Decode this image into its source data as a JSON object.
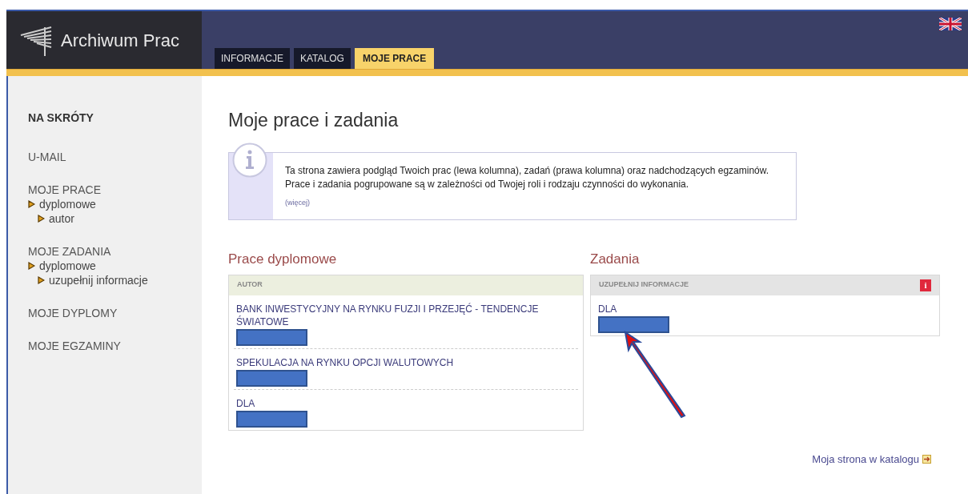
{
  "header": {
    "logo_text": "Archiwum Prac",
    "tabs": [
      {
        "label": "INFORMACJE",
        "selected": false
      },
      {
        "label": "KATALOG",
        "selected": false
      },
      {
        "label": "MOJE PRACE",
        "selected": true
      }
    ]
  },
  "sidebar": {
    "heading": "NA SKRÓTY",
    "items": [
      {
        "label": "U-MAIL"
      },
      {
        "label": "MOJE PRACE",
        "children": [
          {
            "label": "dyplomowe",
            "children": [
              {
                "label": "autor"
              }
            ]
          }
        ]
      },
      {
        "label": "MOJE ZADANIA",
        "children": [
          {
            "label": "dyplomowe",
            "children": [
              {
                "label": "uzupełnij informacje"
              }
            ]
          }
        ]
      },
      {
        "label": "MOJE DYPLOMY"
      },
      {
        "label": "MOJE EGZAMINY"
      }
    ]
  },
  "page_title": "Moje prace i zadania",
  "info": {
    "text": "Ta strona zawiera podgląd Twoich prac (lewa kolumna), zadań (prawa kolumna) oraz nadchodzących egzaminów. Prace i zadania pogrupowane są w zależności od Twojej roli i rodzaju czynności do wykonania.",
    "more": "(więcej)"
  },
  "theses": {
    "title": "Prace dyplomowe",
    "header": "AUTOR",
    "rows": [
      {
        "title": "BANK INWESTYCYJNY NA RYNKU FUZJI I PRZEJĘĆ - TENDENCJE ŚWIATOWE",
        "redacted": true
      },
      {
        "title": "SPEKULACJA NA RYNKU OPCJI WALUTOWYCH",
        "redacted": true
      },
      {
        "title": "DLA",
        "redacted": true
      }
    ]
  },
  "tasks": {
    "title": "Zadania",
    "header": "UZUPEŁNIJ INFORMACJE",
    "alert": "i",
    "rows": [
      {
        "title": "DLA",
        "redacted": true,
        "pointed": true
      }
    ]
  },
  "catalog_link": "Moja strona w katalogu"
}
